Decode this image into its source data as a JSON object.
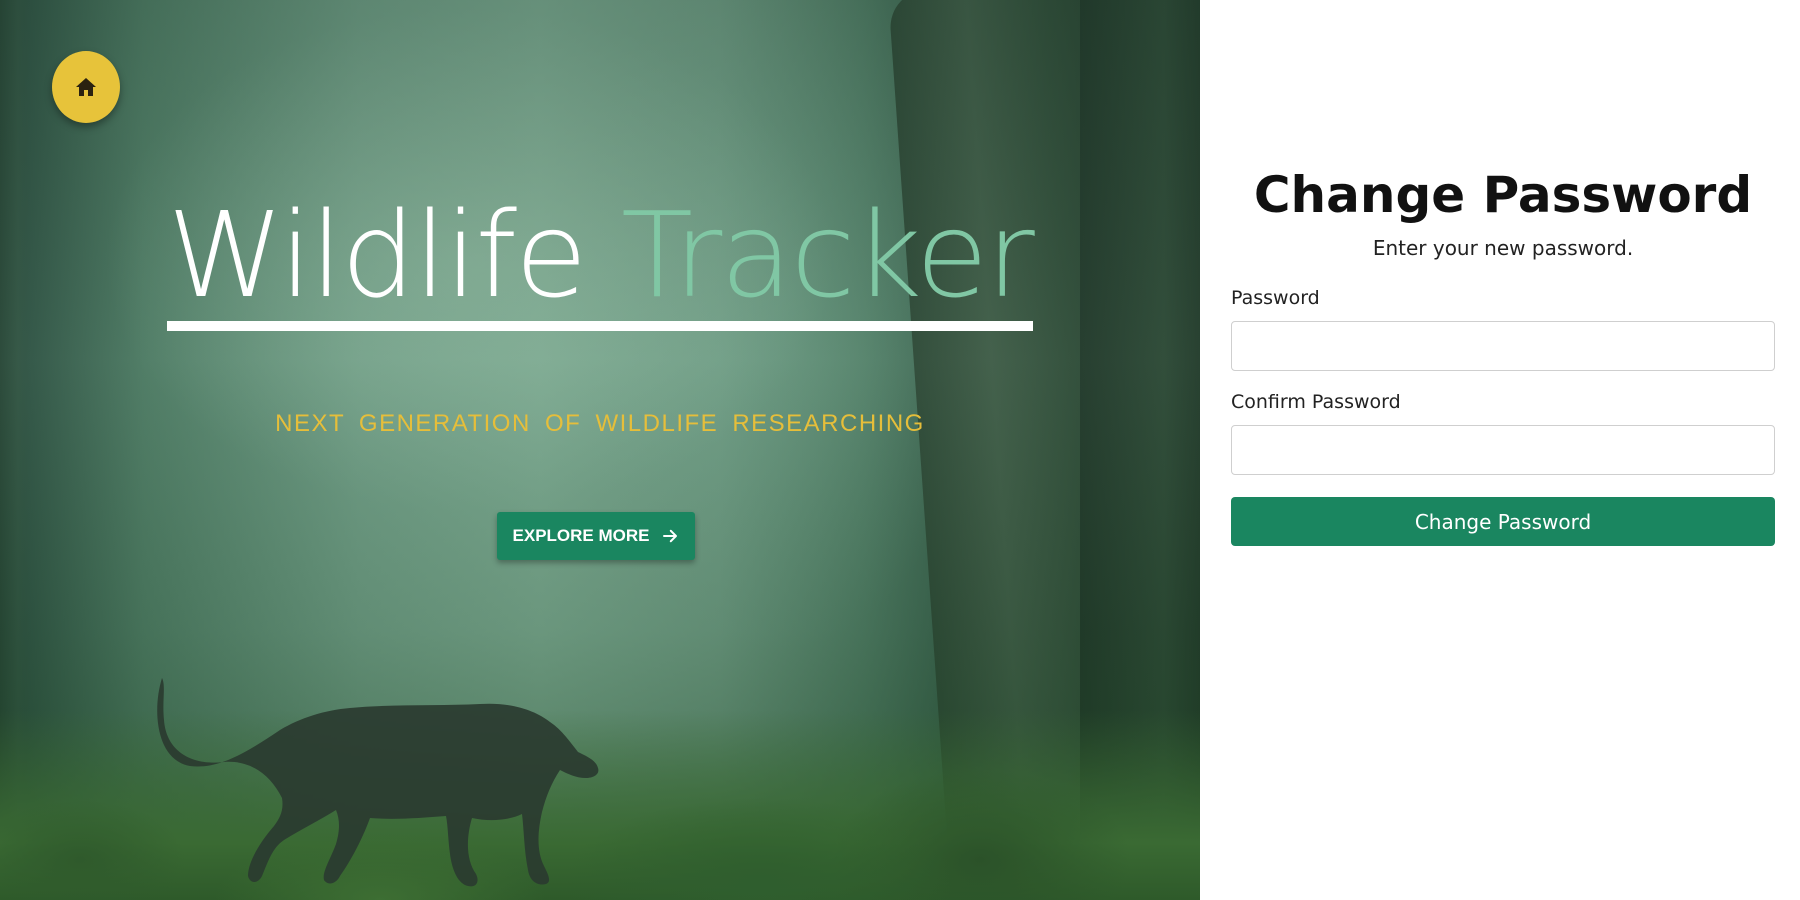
{
  "hero": {
    "home_icon": "home-icon",
    "title_part1": "Wildlife",
    "title_part2": "Tracker",
    "tagline": "NEXT GENERATION OF WILDLIFE RESEARCHING",
    "explore_label": "EXPLORE MORE",
    "explore_icon": "arrow-right-icon",
    "colors": {
      "accent_yellow": "#e7c33a",
      "accent_green": "#1a8660",
      "title_green": "#80c7a4"
    }
  },
  "form": {
    "title": "Change Password",
    "subtitle": "Enter your new password.",
    "password_label": "Password",
    "password_value": "",
    "confirm_label": "Confirm Password",
    "confirm_value": "",
    "submit_label": "Change Password"
  }
}
